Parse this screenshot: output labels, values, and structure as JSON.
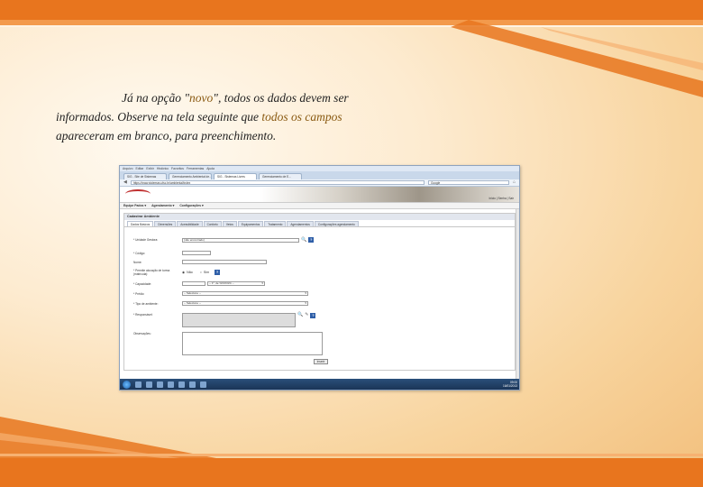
{
  "caption": {
    "line1_pre": "Já na opção \"",
    "line1_hl": "novo",
    "line1_post": "\", todos os dados devem ser",
    "line2_pre": "informados. Observe na tela seguinte que ",
    "line2_hl": "todos os campos",
    "line3": "apareceram em branco, para preenchimento."
  },
  "colors": {
    "accent_orange": "#e8751e",
    "highlight_text": "#8a5a12"
  },
  "screenshot": {
    "browser_menu": [
      "Arquivo",
      "Editar",
      "Exibir",
      "Histórico",
      "Favoritos",
      "Ferramentas",
      "Ajuda"
    ],
    "tabs": [
      {
        "label": "SIG - Site de Sistemas",
        "active": false
      },
      {
        "label": "Gerenciamento Ambiental de...",
        "active": false
      },
      {
        "label": "SIG - Sistemas Livres",
        "active": true
      },
      {
        "label": "Gerenciamento de E...",
        "active": false
      }
    ],
    "url": "https://www.sistemas.ufsc.br/ambiental/index",
    "search_placeholder": "Google",
    "user_links": "Inicio | Senha | Sair",
    "nav": [
      "Equipe Pados ▾",
      "Agendamento ▾",
      "Configurações ▾"
    ],
    "panel_title": "Cadastrar Ambiente",
    "form_tabs": [
      "Dados Básicos",
      "Dimensões",
      "Acessibilidade",
      "Conforto",
      "Vetos",
      "Equipamentos",
      "Tratamento",
      "Agendamentos",
      "Configurações agendamento"
    ],
    "fields": {
      "gestor_label": "* Unidade Gestora:",
      "gestor_value": "(não encontrado)",
      "codigo_label": "* Código:",
      "nome_label": "Nome:",
      "permite_label": "* Permite alocação de turma (matrícula):",
      "permite_nao": "Não",
      "permite_sim": "Sim",
      "capacidade_label": "* Capacidade:",
      "capacidade_value": "-- 1º, de %%%%% --",
      "predio_label": "* Prédio:",
      "predio_value": "-- Selecione --",
      "tipo_label": "* Tipo de ambiente:",
      "tipo_value": "-- Selecione --",
      "responsavel_label": "* Responsável:",
      "observacoes_label": "Observações:"
    },
    "submit_label": "Inserir",
    "clock_time": "09:00",
    "clock_date": "16/01/2013"
  }
}
